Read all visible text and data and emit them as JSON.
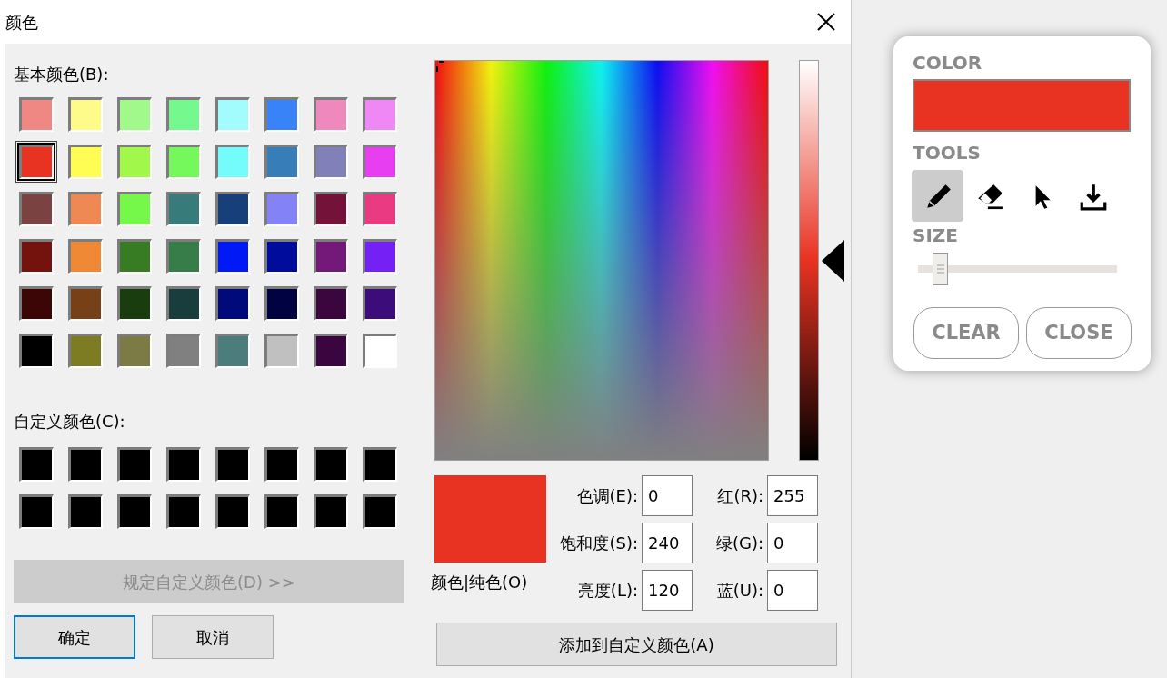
{
  "dialog": {
    "title": "颜色",
    "basic_colors": {
      "label": "基本颜色(B):",
      "swatches": [
        {
          "color": "#ef8883",
          "selected": false
        },
        {
          "color": "#fefb8b",
          "selected": false
        },
        {
          "color": "#a1f88b",
          "selected": false
        },
        {
          "color": "#75f88e",
          "selected": false
        },
        {
          "color": "#a2fcfd",
          "selected": false
        },
        {
          "color": "#3883f7",
          "selected": false
        },
        {
          "color": "#ef88bd",
          "selected": false
        },
        {
          "color": "#ef88f5",
          "selected": false
        },
        {
          "color": "#e83222",
          "selected": true
        },
        {
          "color": "#fffd54",
          "selected": false
        },
        {
          "color": "#a1f84a",
          "selected": false
        },
        {
          "color": "#75f85c",
          "selected": false
        },
        {
          "color": "#74fcfd",
          "selected": false
        },
        {
          "color": "#377db8",
          "selected": false
        },
        {
          "color": "#8180b9",
          "selected": false
        },
        {
          "color": "#e83ef1",
          "selected": false
        },
        {
          "color": "#7a4342",
          "selected": false
        },
        {
          "color": "#ef8953",
          "selected": false
        },
        {
          "color": "#75f84a",
          "selected": false
        },
        {
          "color": "#377c7a",
          "selected": false
        },
        {
          "color": "#173f7a",
          "selected": false
        },
        {
          "color": "#8383f7",
          "selected": false
        },
        {
          "color": "#741239",
          "selected": false
        },
        {
          "color": "#e93a82",
          "selected": false
        },
        {
          "color": "#74120e",
          "selected": false
        },
        {
          "color": "#ef8936",
          "selected": false
        },
        {
          "color": "#377c22",
          "selected": false
        },
        {
          "color": "#377d49",
          "selected": false
        },
        {
          "color": "#0019f5",
          "selected": false
        },
        {
          "color": "#000c9b",
          "selected": false
        },
        {
          "color": "#741979",
          "selected": false
        },
        {
          "color": "#7520f5",
          "selected": false
        },
        {
          "color": "#3b0605",
          "selected": false
        },
        {
          "color": "#774117",
          "selected": false
        },
        {
          "color": "#193d0d",
          "selected": false
        },
        {
          "color": "#173d3c",
          "selected": false
        },
        {
          "color": "#000a7b",
          "selected": false
        },
        {
          "color": "#00033f",
          "selected": false
        },
        {
          "color": "#3b053d",
          "selected": false
        },
        {
          "color": "#3b0c7a",
          "selected": false
        },
        {
          "color": "#000000",
          "selected": false
        },
        {
          "color": "#7d7c23",
          "selected": false
        },
        {
          "color": "#7c7b46",
          "selected": false
        },
        {
          "color": "#808080",
          "selected": false
        },
        {
          "color": "#4c7d7d",
          "selected": false
        },
        {
          "color": "#c0c0c0",
          "selected": false
        },
        {
          "color": "#3b053f",
          "selected": false
        },
        {
          "color": "#ffffff",
          "selected": false
        }
      ]
    },
    "custom_colors": {
      "label": "自定义颜色(C):",
      "swatches": [
        {
          "color": "#000000"
        },
        {
          "color": "#000000"
        },
        {
          "color": "#000000"
        },
        {
          "color": "#000000"
        },
        {
          "color": "#000000"
        },
        {
          "color": "#000000"
        },
        {
          "color": "#000000"
        },
        {
          "color": "#000000"
        },
        {
          "color": "#000000"
        },
        {
          "color": "#000000"
        },
        {
          "color": "#000000"
        },
        {
          "color": "#000000"
        },
        {
          "color": "#000000"
        },
        {
          "color": "#000000"
        },
        {
          "color": "#000000"
        },
        {
          "color": "#000000"
        }
      ]
    },
    "define_button": {
      "label": "规定自定义颜色(D) >>",
      "disabled": true
    },
    "buttons": [
      {
        "label": "确定",
        "default": true
      },
      {
        "label": "取消",
        "default": false
      }
    ],
    "luminance_slider": {
      "level": 0.5
    },
    "preview": {
      "color": "#e83222",
      "label": "颜色|纯色(O)"
    },
    "hsl_fields": [
      {
        "label": "色调(E):",
        "value": "0"
      },
      {
        "label": "饱和度(S):",
        "value": "240"
      },
      {
        "label": "亮度(L):",
        "value": "120"
      }
    ],
    "rgb_fields": [
      {
        "label": "红(R):",
        "value": "255"
      },
      {
        "label": "绿(G):",
        "value": "0"
      },
      {
        "label": "蓝(U):",
        "value": "0"
      }
    ],
    "add_button": "添加到自定义颜色(A)"
  },
  "tool_panel": {
    "color_label": "COLOR",
    "color": "#e83222",
    "tools_label": "TOOLS",
    "tools": [
      {
        "kind": "pencil",
        "selected": true
      },
      {
        "kind": "eraser",
        "selected": false
      },
      {
        "kind": "pointer",
        "selected": false
      },
      {
        "kind": "download",
        "selected": false
      }
    ],
    "size_label": "SIZE",
    "size": {
      "level": 0.11
    },
    "buttons": [
      "CLEAR",
      "CLOSE"
    ]
  }
}
